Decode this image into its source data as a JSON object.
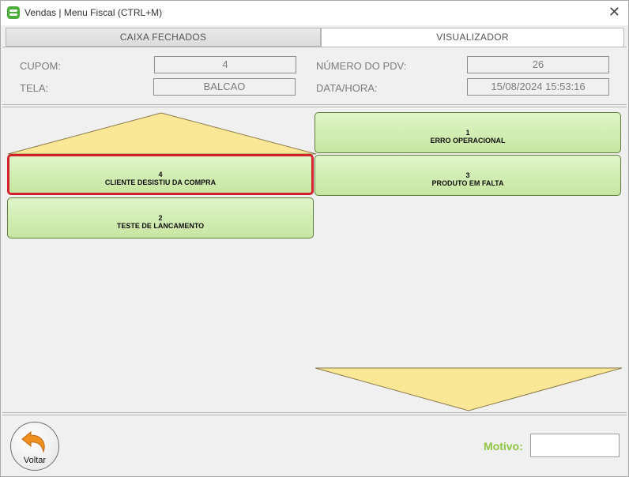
{
  "window": {
    "title": "Vendas | Menu Fiscal (CTRL+M)"
  },
  "tabs": [
    {
      "label": "CAIXA FECHADOS",
      "active": false
    },
    {
      "label": "VISUALIZADOR",
      "active": true
    }
  ],
  "info": {
    "cupom_label": "CUPOM:",
    "cupom_value": "4",
    "tela_label": "TELA:",
    "tela_value": "BALCAO",
    "pdv_label": "NÚMERO DO PDV:",
    "pdv_value": "26",
    "datahora_label": "DATA/HORA:",
    "datahora_value": "15/08/2024 15:53:16"
  },
  "reasons": [
    {
      "num": "1",
      "name": "ERRO OPERACIONAL",
      "selected": false
    },
    {
      "num": "4",
      "name": "CLIENTE DESISTIU DA COMPRA",
      "selected": true
    },
    {
      "num": "3",
      "name": "PRODUTO EM FALTA",
      "selected": false
    },
    {
      "num": "2",
      "name": "TESTE DE LANCAMENTO",
      "selected": false
    }
  ],
  "footer": {
    "voltar_label": "Voltar",
    "motivo_label": "Motivo:",
    "motivo_value": ""
  },
  "colors": {
    "tile_green": "#c7e6a2",
    "arrow_yellow": "#fae896",
    "selected_border": "#d2232a",
    "motivo_green": "#8dc63f",
    "voltar_arrow": "#f0901e"
  },
  "icons": {
    "app": "app-logo-icon",
    "close": "close-icon",
    "scroll_up": "scroll-up-arrow-icon",
    "scroll_down": "scroll-down-arrow-icon",
    "voltar": "back-arrow-icon"
  }
}
